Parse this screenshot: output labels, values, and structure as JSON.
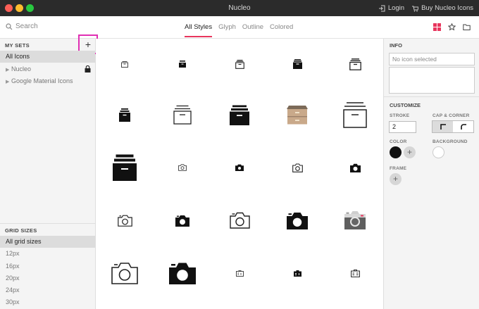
{
  "window": {
    "title": "Nucleo",
    "login": "Login",
    "buy": "Buy Nucleo Icons"
  },
  "toolbar": {
    "search_placeholder": "Search",
    "tabs": [
      {
        "label": "All Styles",
        "active": true
      },
      {
        "label": "Glyph",
        "active": false
      },
      {
        "label": "Outline",
        "active": false
      },
      {
        "label": "Colored",
        "active": false
      }
    ]
  },
  "sidebar": {
    "my_sets": "MY SETS",
    "add": "+",
    "sets": [
      {
        "label": "All Icons"
      },
      {
        "label": "Nucleo"
      },
      {
        "label": "Google Material Icons"
      }
    ],
    "grid_sizes": "GRID SIZES",
    "sizes": [
      {
        "label": "All grid sizes"
      },
      {
        "label": "12px"
      },
      {
        "label": "16px"
      },
      {
        "label": "20px"
      },
      {
        "label": "24px"
      },
      {
        "label": "30px"
      }
    ]
  },
  "panel": {
    "info": "INFO",
    "no_icon": "No icon selected",
    "customize": "CUSTOMIZE",
    "stroke_label": "STROKE",
    "stroke_value": "2",
    "cap_label": "CAP & CORNER",
    "color_label": "COLOR",
    "background_label": "BACKGROUND",
    "frame_label": "FRAME",
    "plus": "+"
  },
  "colors": {
    "accent": "#e8365d",
    "highlight": "#e02fb3"
  },
  "icons": [
    "archive-icon",
    "archive-icon",
    "archive-icon",
    "archive-icon",
    "archive-icon",
    "archive-icon",
    "archive-icon",
    "archive-icon",
    "archive-icon",
    "archive-icon",
    "archive-icon",
    "camera-icon",
    "camera-icon",
    "camera-icon",
    "camera-icon",
    "camera-icon",
    "camera-icon",
    "camera-icon",
    "camera-icon",
    "camera-icon",
    "camera-icon",
    "camera-icon",
    "badge-icon",
    "badge-icon",
    "badge-icon"
  ]
}
